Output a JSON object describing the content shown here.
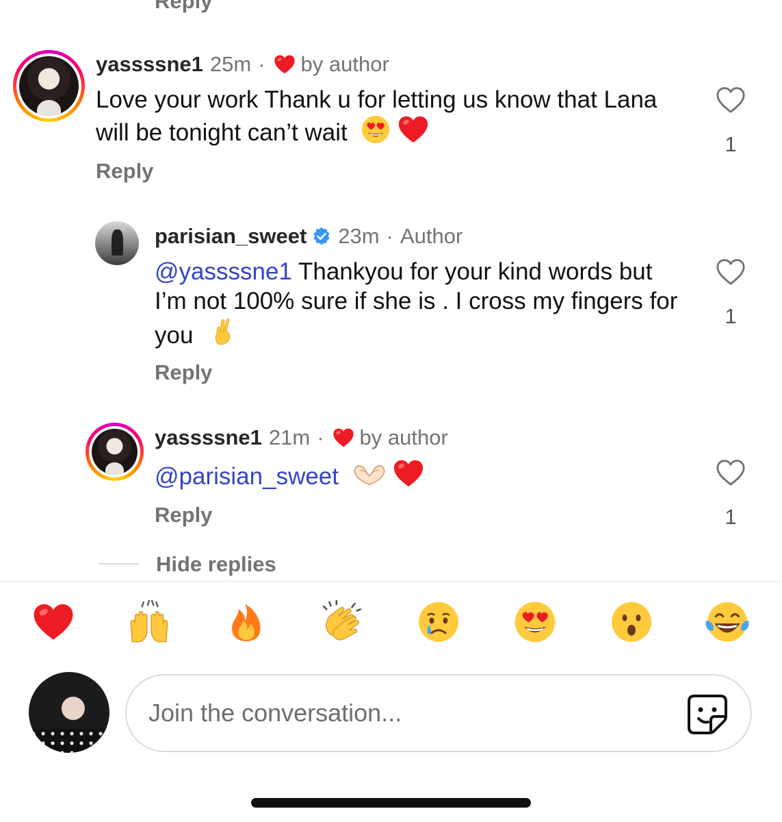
{
  "top": {
    "partial_reply_label": "Reply"
  },
  "comments": [
    {
      "username": "yassssne1",
      "time": "25m",
      "separator": "·",
      "liked_by_label": "by author",
      "text": "Love your work Thank u for letting us know that Lana will be tonight can’t wait",
      "emojis": [
        "smiling-heart-eyes",
        "red-heart"
      ],
      "reply_label": "Reply",
      "like_count": "1",
      "avatar_ring": true
    },
    {
      "username": "parisian_sweet",
      "verified": true,
      "time": "23m",
      "separator": "·",
      "role_label": "Author",
      "mention": "@yassssne1",
      "text": " Thankyou for your kind words but I’m not 100% sure if she is . I cross my fingers for you",
      "emojis": [
        "crossed-fingers"
      ],
      "reply_label": "Reply",
      "like_count": "1"
    },
    {
      "username": "yassssne1",
      "time": "21m",
      "separator": "·",
      "liked_by_label": "by author",
      "mention": "@parisian_sweet",
      "emojis": [
        "heart-hands",
        "red-heart"
      ],
      "reply_label": "Reply",
      "like_count": "1",
      "avatar_ring": true
    }
  ],
  "hide_replies_label": "Hide replies",
  "quick_reactions": [
    "red-heart",
    "raising-hands",
    "fire",
    "clapping-hands",
    "crying-face",
    "heart-eyes",
    "surprised-face",
    "tears-of-joy"
  ],
  "composer": {
    "placeholder": "Join the conversation...",
    "sticker_icon": "sticker-icon"
  },
  "colors": {
    "mention": "#3445c4",
    "heart": "#ed1c24",
    "verified": "#3897f0",
    "muted": "#737373"
  }
}
